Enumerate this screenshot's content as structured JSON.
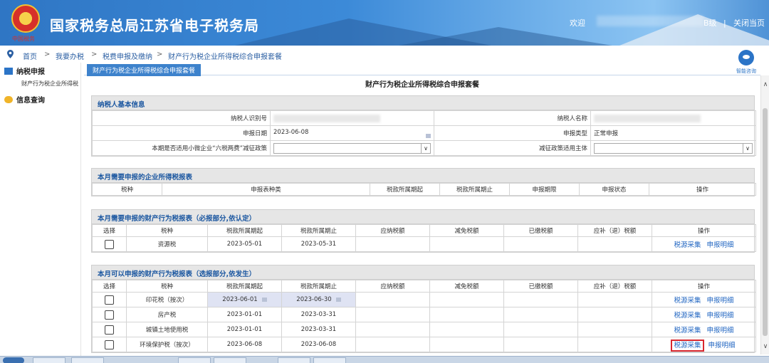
{
  "header": {
    "title": "国家税务总局江苏省电子税务局",
    "emblem_text": "中国税务",
    "welcome": "欢迎",
    "user_level": "B级",
    "close_label": "关闭当页",
    "separator": "|"
  },
  "breadcrumb": {
    "items": [
      "首页",
      "我要办税",
      "税费申报及缴纳"
    ],
    "current": "财产行为税企业所得税综合申报套餐",
    "sep": ">"
  },
  "help": {
    "label": "智能咨询"
  },
  "sidebar": {
    "section1": "纳税申报",
    "section1_item": "财产行为税企业所得税",
    "section2": "信息查询"
  },
  "tab": {
    "label": "财产行为税企业所得税综合申报套餐"
  },
  "page_title": "财产行为税企业所得税综合申报套餐",
  "basic_info": {
    "heading": "纳税人基本信息",
    "taxpayer_id_label": "纳税人识别号",
    "taxpayer_name_label": "纳税人名称",
    "declare_date_label": "申报日期",
    "declare_date_value": "2023-06-08",
    "declare_type_label": "申报类型",
    "declare_type_value": "正常申报",
    "policy_label": "本期是否适用小微企业“六税两费”减征政策",
    "policy_subject_label": "减征政策适用主体"
  },
  "cit_section": {
    "heading": "本月需要申报的企业所得税报表",
    "columns": [
      "税种",
      "申报表种类",
      "税款所属期起",
      "税款所属期止",
      "申报期限",
      "申报状态",
      "操作"
    ]
  },
  "required_section": {
    "heading": "本月需要申报的财产行为税报表（必报部分,依认定）",
    "columns": [
      "选择",
      "税种",
      "税款所属期起",
      "税款所属期止",
      "应纳税额",
      "减免税额",
      "已缴税额",
      "应补（退）税额",
      "操作"
    ],
    "rows": [
      {
        "tax": "资源税",
        "start": "2023-05-01",
        "end": "2023-05-31",
        "op1": "税源采集",
        "op2": "申报明细"
      }
    ]
  },
  "optional_section": {
    "heading": "本月可以申报的财产行为税报表（选报部分,依发生）",
    "columns": [
      "选择",
      "税种",
      "税款所属期起",
      "税款所属期止",
      "应纳税额",
      "减免税额",
      "已缴税额",
      "应补（退）税额",
      "操作"
    ],
    "rows": [
      {
        "tax": "印花税（按次）",
        "start": "2023-06-01",
        "end": "2023-06-30",
        "op1": "税源采集",
        "op2": "申报明细"
      },
      {
        "tax": "房产税",
        "start": "2023-01-01",
        "end": "2023-03-31",
        "op1": "税源采集",
        "op2": "申报明细"
      },
      {
        "tax": "城镇土地使用税",
        "start": "2023-01-01",
        "end": "2023-03-31",
        "op1": "税源采集",
        "op2": "申报明细"
      },
      {
        "tax": "环境保护税（按次）",
        "start": "2023-06-08",
        "end": "2023-06-08",
        "op1": "税源采集",
        "op2": "申报明细"
      }
    ]
  },
  "colors": {
    "header_blue": "#3c8ad8",
    "tab_blue": "#3d82cc",
    "link_blue": "#2166c2",
    "highlight_red": "#d9272e",
    "section_title": "#1a56a0"
  }
}
